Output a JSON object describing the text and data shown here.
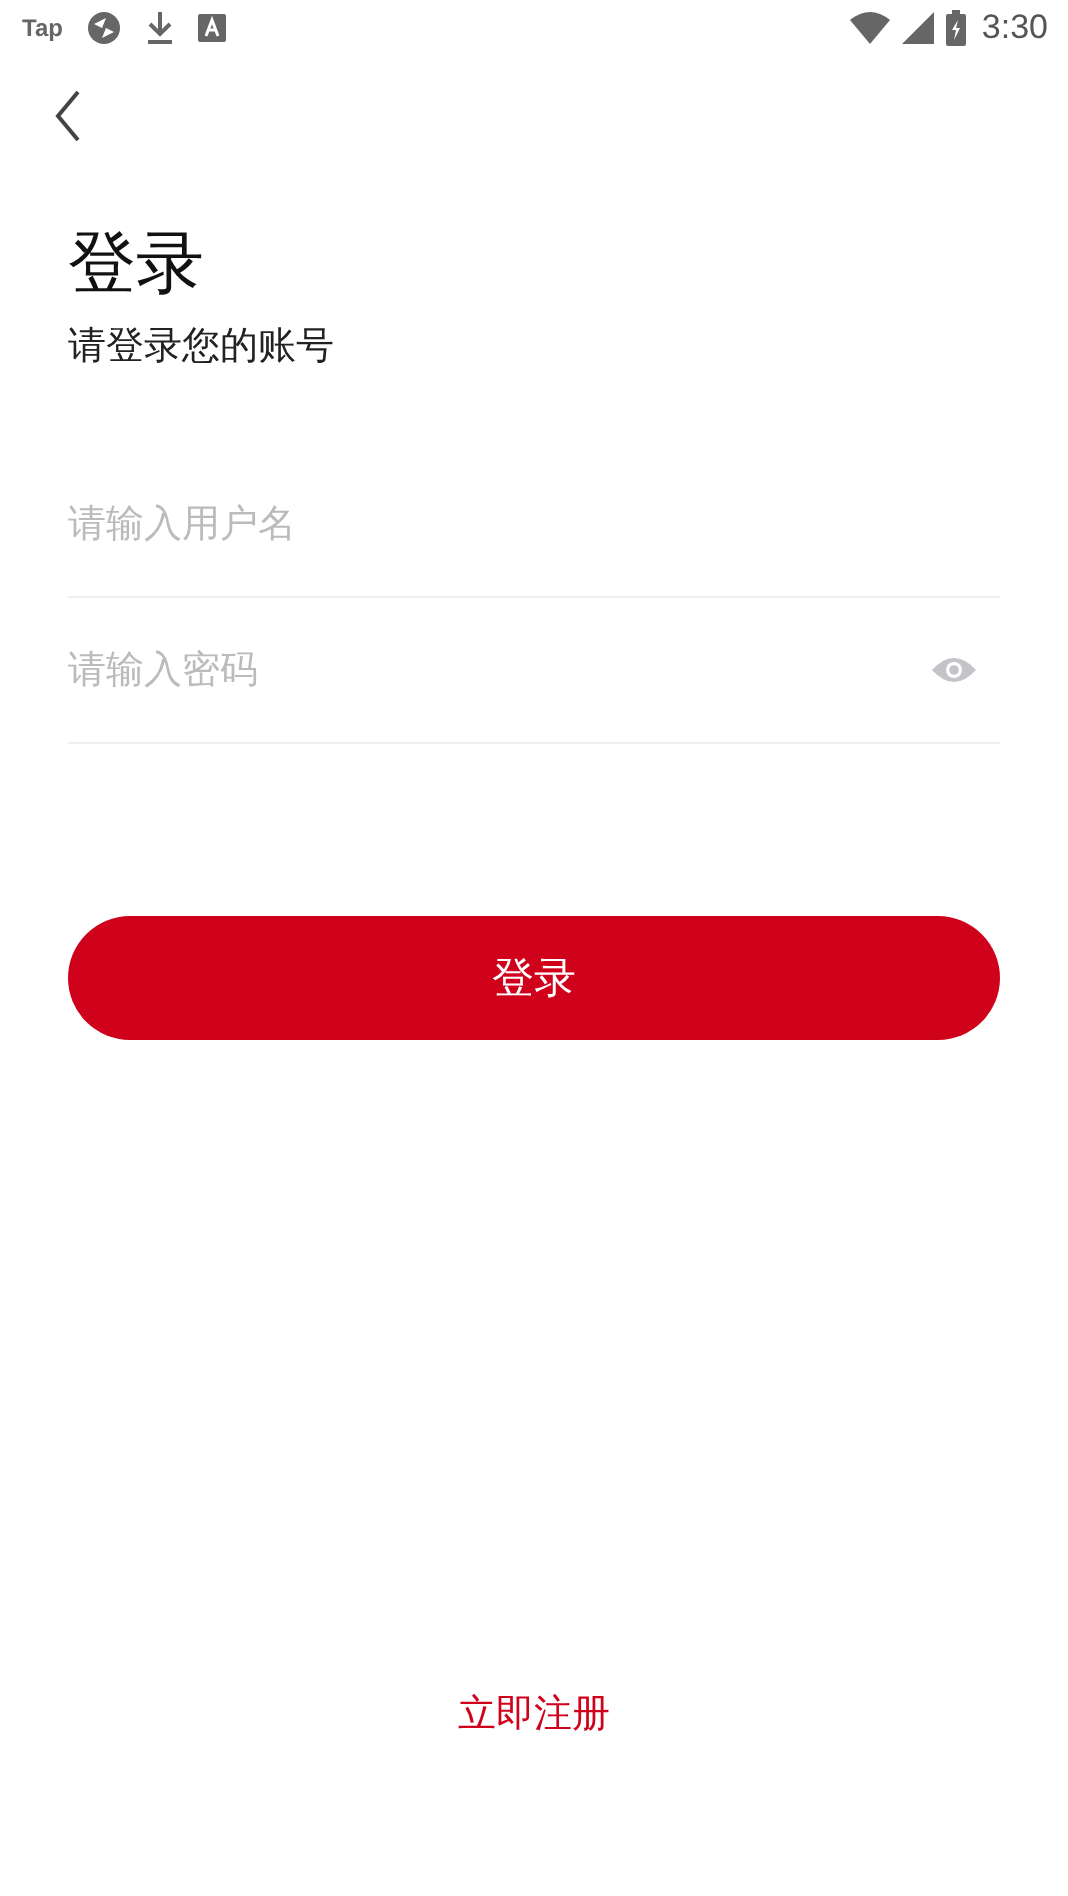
{
  "status_bar": {
    "app_label": "Tap",
    "time": "3:30"
  },
  "title": "登录",
  "subtitle": "请登录您的账号",
  "fields": [
    {
      "kind": "text",
      "placeholder": "请输入用户名"
    },
    {
      "kind": "password",
      "placeholder": "请输入密码"
    }
  ],
  "login_button": "登录",
  "register_link": "立即注册"
}
